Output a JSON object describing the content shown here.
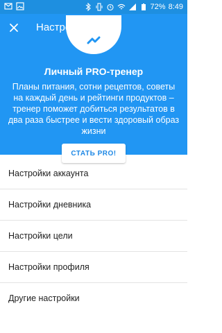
{
  "status_bar": {
    "battery": "72%",
    "time": "8:49",
    "icons": [
      "mail-icon",
      "image-icon",
      "bluetooth-icon",
      "vibrate-icon",
      "alarm-icon",
      "wifi-icon",
      "signal-icon",
      "battery-icon"
    ]
  },
  "appbar": {
    "title": "Настройки",
    "close_icon": "close-icon"
  },
  "promo": {
    "title": "Личный PRO-тренер",
    "text": "Планы питания, сотни рецептов, советы на каждый день и рейтинги продуктов – тренер поможет добиться результатов в два раза быстрее и вести здоровый образ жизни",
    "button": "СТАТЬ PRO!"
  },
  "settings": [
    {
      "label": "Настройки аккаунта"
    },
    {
      "label": "Настройки дневника"
    },
    {
      "label": "Настройки цели"
    },
    {
      "label": "Настройки профиля"
    },
    {
      "label": "Другие настройки"
    }
  ],
  "colors": {
    "primary": "#2196f3",
    "status_bar": "#1e8fe0",
    "button_text": "#1e88e5"
  }
}
